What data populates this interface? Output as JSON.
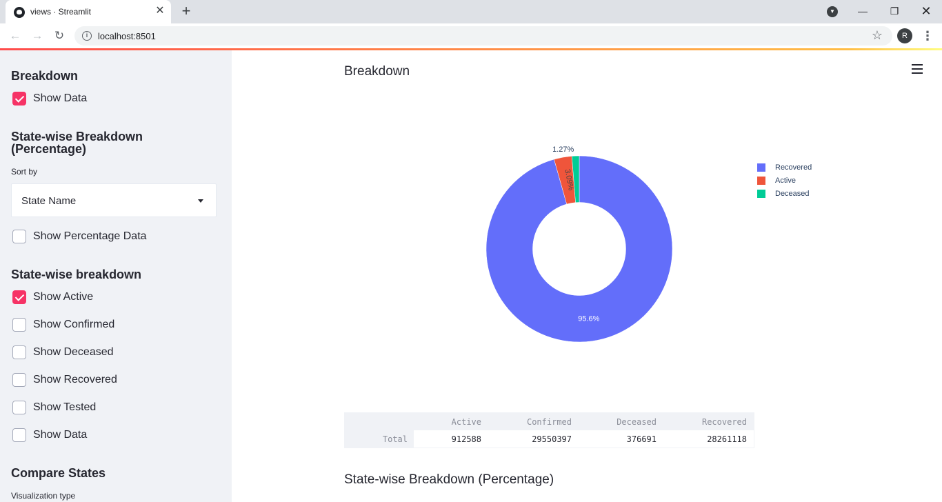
{
  "browser": {
    "tab_title": "views · Streamlit",
    "url": "localhost:8501",
    "profile_initial": "R"
  },
  "sidebar": {
    "breakdown_heading": "Breakdown",
    "breakdown_show_data": {
      "label": "Show Data",
      "checked": true
    },
    "pct_heading": "State-wise Breakdown (Percentage)",
    "sort_label": "Sort by",
    "sort_value": "State Name",
    "show_pct_data": {
      "label": "Show Percentage Data",
      "checked": false
    },
    "statewise_heading": "State-wise breakdown",
    "show_active": {
      "label": "Show Active",
      "checked": true
    },
    "show_confirmed": {
      "label": "Show Confirmed",
      "checked": false
    },
    "show_deceased": {
      "label": "Show Deceased",
      "checked": false
    },
    "show_recovered": {
      "label": "Show Recovered",
      "checked": false
    },
    "show_tested": {
      "label": "Show Tested",
      "checked": false
    },
    "statewise_show_data": {
      "label": "Show Data",
      "checked": false
    },
    "compare_heading": "Compare States",
    "viz_type_label": "Visualization type"
  },
  "main": {
    "title": "Breakdown",
    "section_title": "State-wise Breakdown (Percentage)",
    "table": {
      "columns": [
        "Active",
        "Confirmed",
        "Deceased",
        "Recovered"
      ],
      "rows": [
        {
          "index": "Total",
          "values": [
            "912588",
            "29550397",
            "376691",
            "28261118"
          ]
        }
      ]
    }
  },
  "colors": {
    "recovered": "#636efa",
    "active": "#ef553b",
    "deceased": "#00cc96",
    "accent": "#f63366"
  },
  "chart_data": {
    "type": "pie",
    "hole": 0.5,
    "labels": [
      "Recovered",
      "Active",
      "Deceased"
    ],
    "values": [
      28261118,
      912588,
      376691
    ],
    "slice_labels": [
      "95.6%",
      "3.09%",
      "1.27%"
    ],
    "legend": "top-right",
    "title": ""
  }
}
